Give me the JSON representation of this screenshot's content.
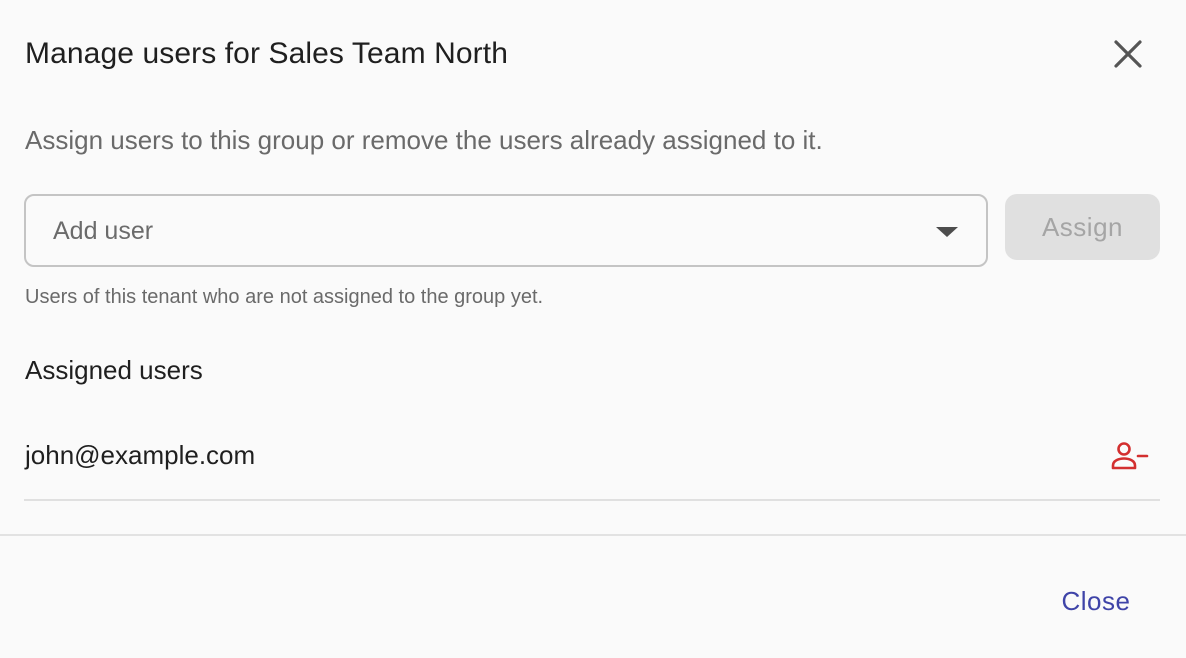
{
  "dialog": {
    "title": "Manage users for Sales Team North",
    "close_icon": "close-icon",
    "description": "Assign users to this group or remove the users already assigned to it."
  },
  "add_user": {
    "placeholder": "Add user",
    "dropdown_icon": "chevron-down-icon",
    "assign_label": "Assign",
    "assign_enabled": false,
    "helper_text": "Users of this tenant who are not assigned to the group yet."
  },
  "assigned_users": {
    "heading": "Assigned users",
    "users": [
      {
        "email": "john@example.com",
        "remove_icon": "person-remove-icon"
      }
    ]
  },
  "footer": {
    "close_label": "Close"
  },
  "colors": {
    "background": "#fafafa",
    "primary": "#3f44a8",
    "danger": "#d32f2f",
    "disabled_bg": "#e0e0e0",
    "disabled_text": "#a5a5a5"
  }
}
